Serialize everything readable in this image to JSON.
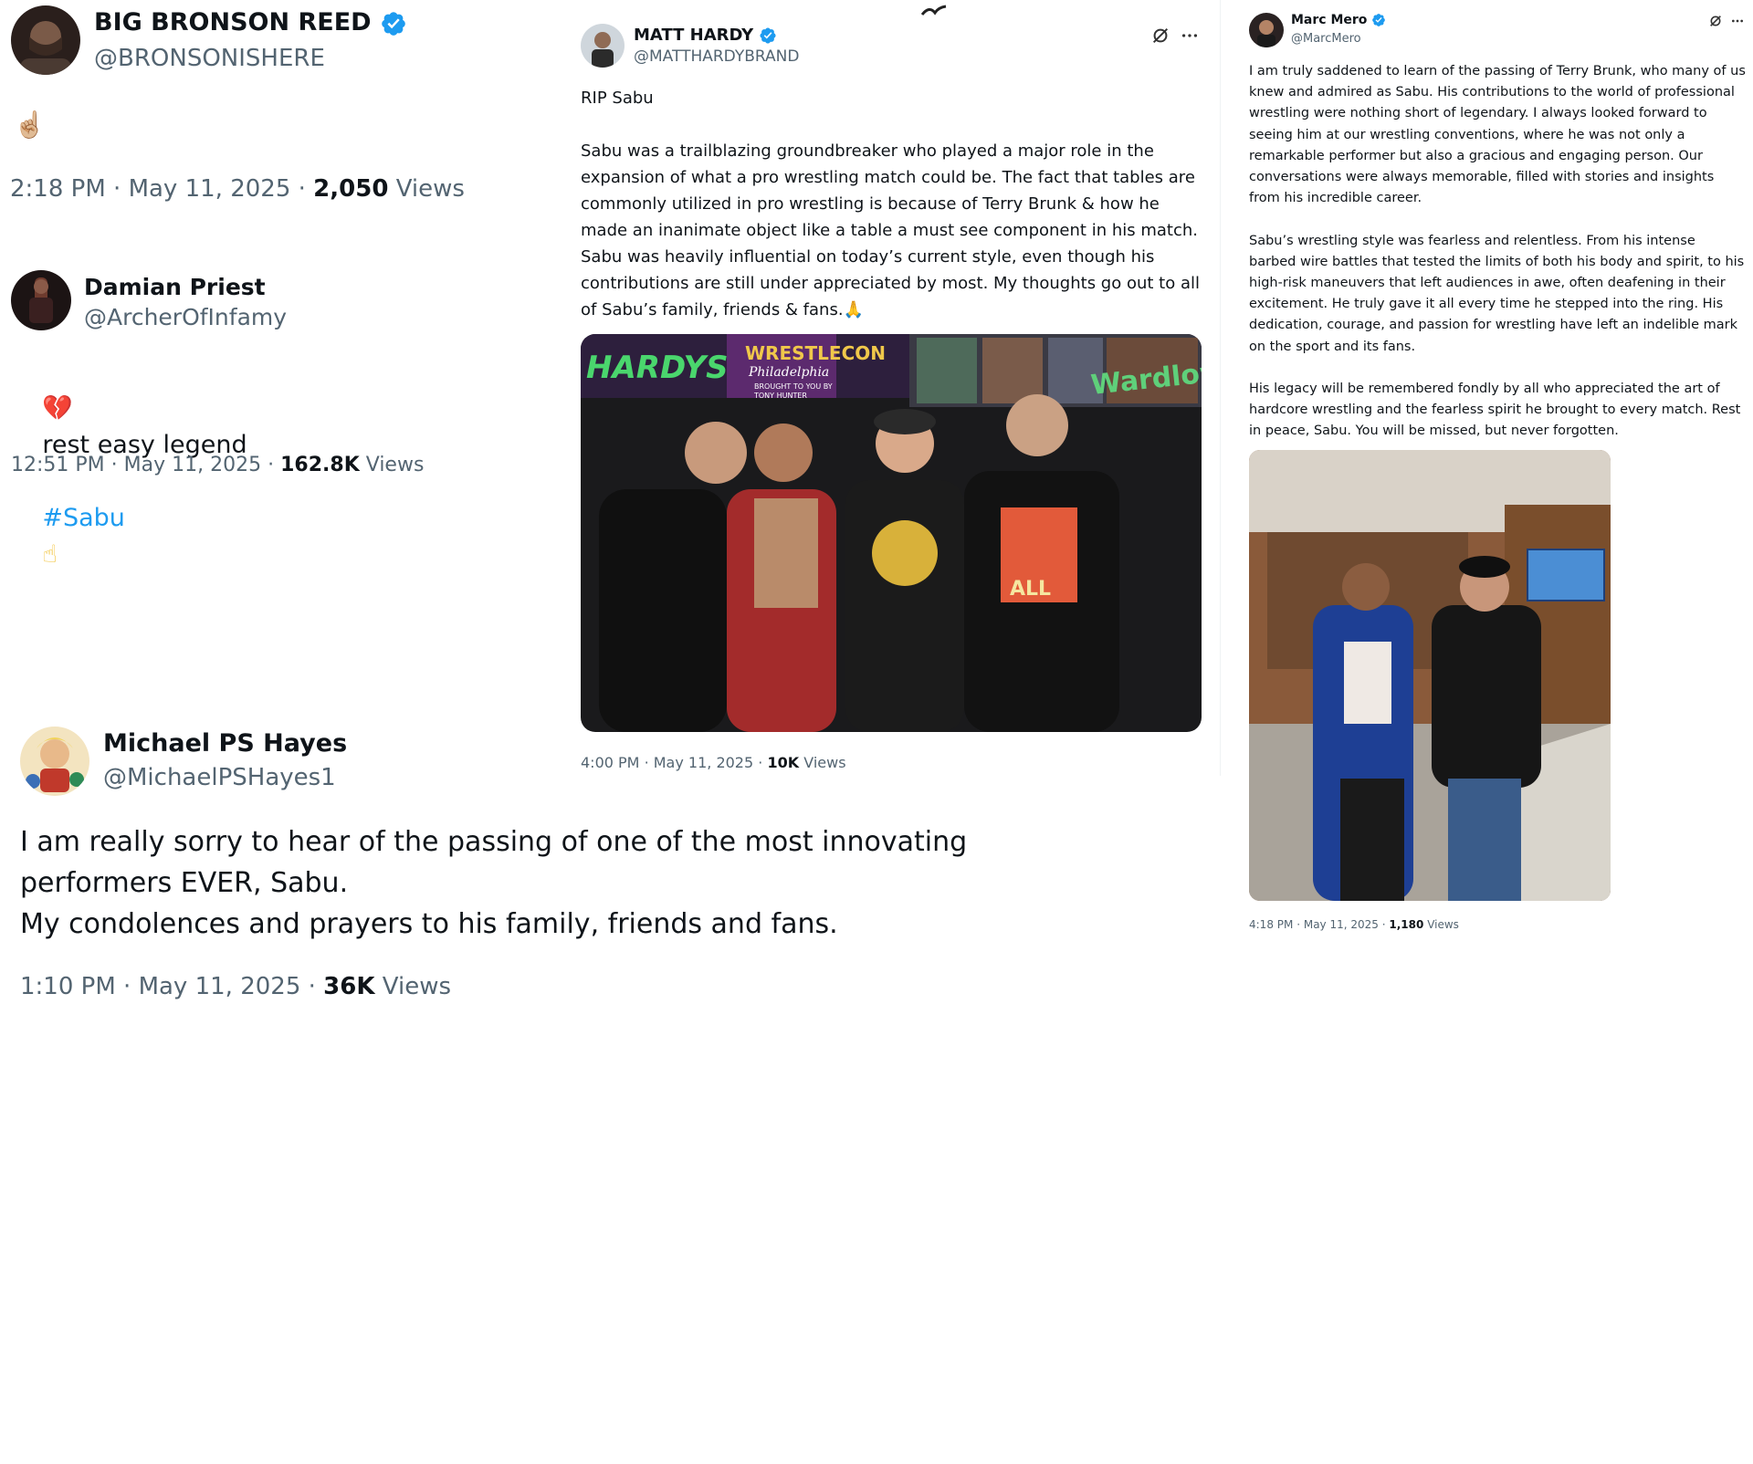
{
  "accent_color": "#1d9bf0",
  "verified_icon": "verified-badge-icon",
  "tweets": {
    "bronson": {
      "display_name": "BIG BRONSON REED",
      "handle": "@BRONSONISHERE",
      "text": "☝🏼",
      "time": "2:18 PM",
      "date": "May 11, 2025",
      "views_count": "2,050",
      "views_label": "Views",
      "sep": "·"
    },
    "priest": {
      "display_name": "Damian Priest",
      "handle": "@ArcherOfInfamy",
      "text_line1": "rest easy legend",
      "hashtag": "#Sabu",
      "heart_emoji": "💔",
      "finger_emoji": "☝",
      "time": "12:51 PM",
      "date": "May 11, 2025",
      "views_count": "162.8K",
      "views_label": "Views",
      "sep": "·"
    },
    "hayes": {
      "display_name": "Michael PS Hayes",
      "handle": "@MichaelPSHayes1",
      "text": "I am really sorry to hear of the passing of one of the most innovating\nperformers EVER, Sabu.\nMy condolences and prayers to his family, friends and fans.",
      "time": "1:10 PM",
      "date": "May 11, 2025",
      "views_count": "36K",
      "views_label": "Views",
      "sep": "·"
    },
    "hardy": {
      "display_name": "MATT HARDY",
      "handle": "@MATTHARDYBRAND",
      "text": "RIP Sabu\n\nSabu was a trailblazing groundbreaker who played a major role in the expansion of what a pro wrestling match could be. The fact that tables are commonly utilized in pro wrestling is because of Terry Brunk & how he made an inanimate object like a table a must see component in his match. Sabu was heavily influential on today’s current style, even though his contributions are still under appreciated by most. My thoughts go out to all of Sabu’s family, friends & fans.🙏",
      "photo_text_1": "HARDYS",
      "photo_text_2": "WRESTLECON",
      "photo_text_3": "Philadelphia",
      "photo_text_4": "BROUGHT TO YOU BY",
      "photo_text_5": "TONY HUNTER",
      "photo_text_6": "Wardlow",
      "photo_text_7": "ALL",
      "time": "4:00 PM",
      "date": "May 11, 2025",
      "views_count": "10K",
      "views_label": "Views",
      "sep": "·"
    },
    "mero": {
      "display_name": "Marc Mero",
      "handle": "@MarcMero",
      "text": "I am truly saddened to learn of the passing of Terry Brunk, who many of us knew and admired as Sabu. His contributions to the world of professional wrestling were nothing short of legendary. I always looked forward to seeing him at our wrestling conventions, where he was not only a remarkable performer but also a gracious and engaging person. Our conversations were always memorable, filled with stories and insights from his incredible career.\n\nSabu’s wrestling style was fearless and relentless. From his intense barbed wire battles that tested the limits of both his body and spirit, to his high-risk maneuvers that left audiences in awe, often deafening in their excitement. He truly gave it all every time he stepped into the ring. His dedication, courage, and passion for wrestling have left an indelible mark on the sport and its fans.\n\nHis legacy will be remembered fondly by all who appreciated the art of hardcore wrestling and the fearless spirit he brought to every match. Rest in peace, Sabu. You will be missed, but never forgotten.",
      "time": "4:18 PM",
      "date": "May 11, 2025",
      "views_count": "1,180",
      "views_label": "Views",
      "sep": "·"
    }
  }
}
